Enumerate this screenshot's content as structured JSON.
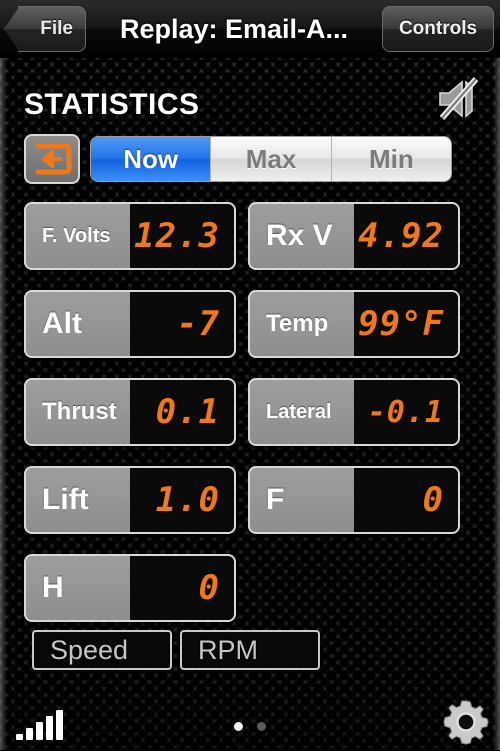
{
  "titlebar": {
    "back_label": "File",
    "title": "Replay: Email-A...",
    "controls_label": "Controls"
  },
  "header": {
    "heading": "STATISTICS",
    "mute_icon": "mute-speaker-icon",
    "loop_icon": "return-arrow-icon"
  },
  "segmented": {
    "options": [
      {
        "label": "Now",
        "active": true
      },
      {
        "label": "Max",
        "active": false
      },
      {
        "label": "Min",
        "active": false
      }
    ]
  },
  "stats": [
    {
      "label": "F. Volts",
      "value": "12.3"
    },
    {
      "label": "Rx V",
      "value": "4.92"
    },
    {
      "label": "Alt",
      "value": "-7"
    },
    {
      "label": "Temp",
      "value": "99°F"
    },
    {
      "label": "Thrust",
      "value": "0.1"
    },
    {
      "label": "Lateral",
      "value": "-0.1"
    },
    {
      "label": "Lift",
      "value": "1.0"
    },
    {
      "label": "F",
      "value": "0"
    },
    {
      "label": "H",
      "value": "0"
    }
  ],
  "extra_buttons": [
    {
      "label": "Speed"
    },
    {
      "label": "RPM"
    }
  ],
  "bottombar": {
    "signal_icon": "signal-bars-icon",
    "gear_icon": "gear-icon",
    "page_count": 2,
    "page_active": 1
  },
  "colors": {
    "accent_orange": "#f07818",
    "accent_blue": "#2474ea",
    "panel_gray": "#9a9a9a",
    "display_black": "#0a0a0a"
  }
}
